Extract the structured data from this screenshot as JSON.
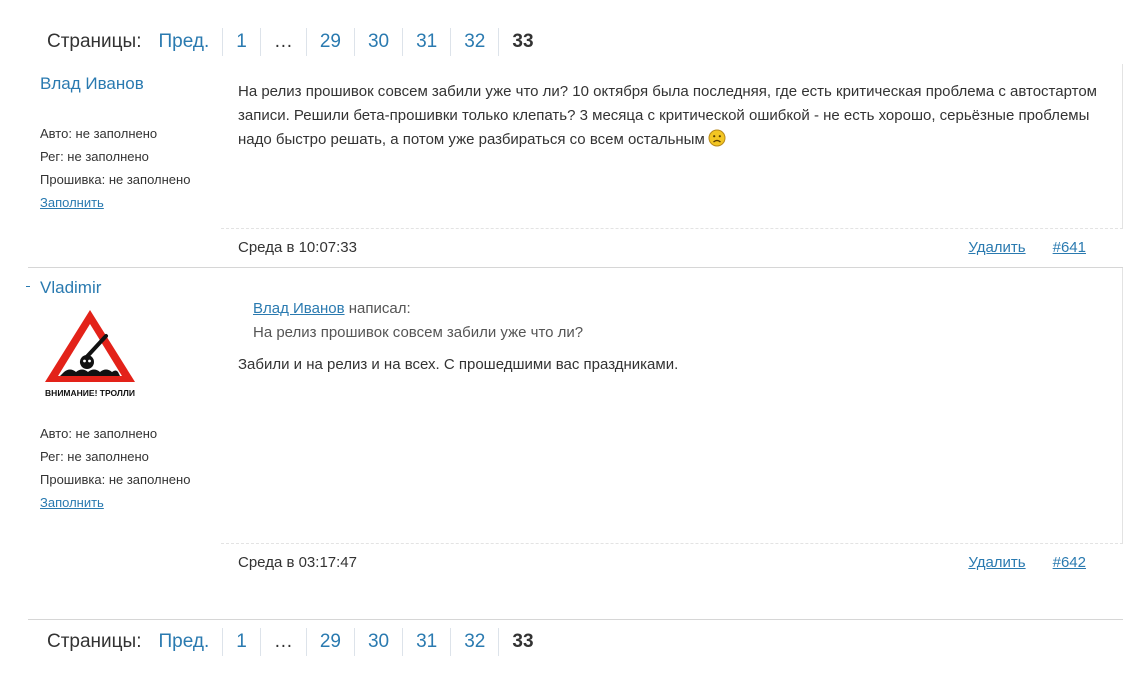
{
  "pager_top": {
    "label": "Страницы:",
    "prev": "Пред.",
    "pages": [
      "1",
      "…",
      "29",
      "30",
      "31",
      "32"
    ],
    "current": "33"
  },
  "pager_bottom": {
    "label": "Страницы:",
    "prev": "Пред.",
    "pages": [
      "1",
      "…",
      "29",
      "30",
      "31",
      "32"
    ],
    "current": "33"
  },
  "posts": [
    {
      "author": "Влад Иванов",
      "auto": "Авто: не заполнено",
      "reg": "Рег: не заполнено",
      "firmware": "Прошивка: не заполнено",
      "fill_link": "Заполнить",
      "text": "На релиз прошивок совсем забили уже что ли? 10 октября была последняя, где есть критическая проблема с автостартом записи. Решили бета-прошивки только клепать? 3 месяца с критической ошибкой - не есть хорошо, серьёзные проблемы надо быстро решать, а потом уже разбираться со всем остальным",
      "emoji": "sad-face",
      "time": "Среда в 10:07:33",
      "delete_label": "Удалить",
      "post_id": "#641"
    },
    {
      "author": "Vladimir",
      "avatar_caption": "ВНИМАНИЕ! ТРОЛЛИ",
      "auto": "Авто: не заполнено",
      "reg": "Рег: не заполнено",
      "firmware": "Прошивка: не заполнено",
      "fill_link": "Заполнить",
      "quote_author": "Влад Иванов",
      "quote_wrote": "написал:",
      "quote_text": "На релиз прошивок совсем забили уже что ли?",
      "text": "Забили и на релиз и на всех. С прошедшими вас праздниками.",
      "time": "Среда в 03:17:47",
      "delete_label": "Удалить",
      "post_id": "#642"
    }
  ],
  "colors": {
    "link": "#2a7ab0",
    "text": "#333333",
    "warning_red": "#e32219"
  }
}
